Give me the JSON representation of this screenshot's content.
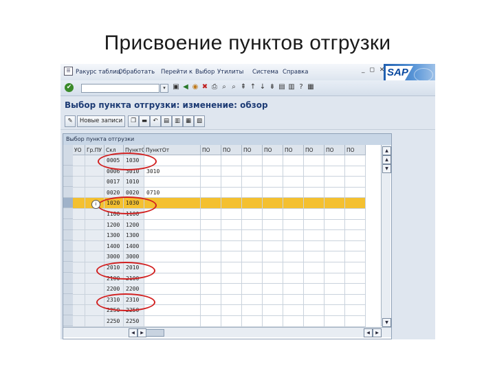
{
  "slide": {
    "title": "Присвоение пунктов отгрузки"
  },
  "menu": {
    "items": [
      "Ракурс таблиц",
      "Обработать",
      "Перейти к",
      "Выбор",
      "Утилиты",
      "Система",
      "Справка"
    ],
    "window_controls": "_ ◻ ✕",
    "logo_text": "SAP"
  },
  "toolbar": {
    "ok_icon": "check-icon",
    "command_value": ""
  },
  "screen": {
    "title": "Выбор пункта отгрузки: изменение: обзор"
  },
  "app_toolbar": {
    "new_entries_label": "Новые записи"
  },
  "table": {
    "title": "Выбор пункта отгрузки",
    "columns": [
      "УО",
      "Гр.ПУ",
      "Скл",
      "ПунктОт",
      "ПунктОт",
      "ПО",
      "ПО",
      "ПО",
      "ПО",
      "ПО",
      "ПО",
      "ПО",
      "ПО"
    ],
    "rows": [
      {
        "c1": "",
        "c2": "",
        "c3": "0005",
        "c4": "1030",
        "c5": ""
      },
      {
        "c1": "",
        "c2": "",
        "c3": "0006",
        "c4": "3010",
        "c5": "3010"
      },
      {
        "c1": "",
        "c2": "",
        "c3": "0017",
        "c4": "1010",
        "c5": ""
      },
      {
        "c1": "",
        "c2": "",
        "c3": "0020",
        "c4": "0020",
        "c5": "0710"
      },
      {
        "c1": "",
        "c2": "",
        "c3": "1020",
        "c4": "1030",
        "c5": ""
      },
      {
        "c1": "",
        "c2": "",
        "c3": "1100",
        "c4": "1100",
        "c5": ""
      },
      {
        "c1": "",
        "c2": "",
        "c3": "1200",
        "c4": "1200",
        "c5": ""
      },
      {
        "c1": "",
        "c2": "",
        "c3": "1300",
        "c4": "1300",
        "c5": ""
      },
      {
        "c1": "",
        "c2": "",
        "c3": "1400",
        "c4": "1400",
        "c5": ""
      },
      {
        "c1": "",
        "c2": "",
        "c3": "3000",
        "c4": "3000",
        "c5": ""
      },
      {
        "c1": "",
        "c2": "",
        "c3": "2010",
        "c4": "2010",
        "c5": ""
      },
      {
        "c1": "",
        "c2": "",
        "c3": "2100",
        "c4": "2100",
        "c5": ""
      },
      {
        "c1": "",
        "c2": "",
        "c3": "2200",
        "c4": "2200",
        "c5": ""
      },
      {
        "c1": "",
        "c2": "",
        "c3": "2310",
        "c4": "2310",
        "c5": ""
      },
      {
        "c1": "",
        "c2": "",
        "c3": "2250",
        "c4": "2250",
        "c5": ""
      },
      {
        "c1": "",
        "c2": "",
        "c3": "2250",
        "c4": "2250",
        "c5": ""
      }
    ],
    "highlight_color": "#f4c030",
    "circle_color": "#d22020"
  }
}
